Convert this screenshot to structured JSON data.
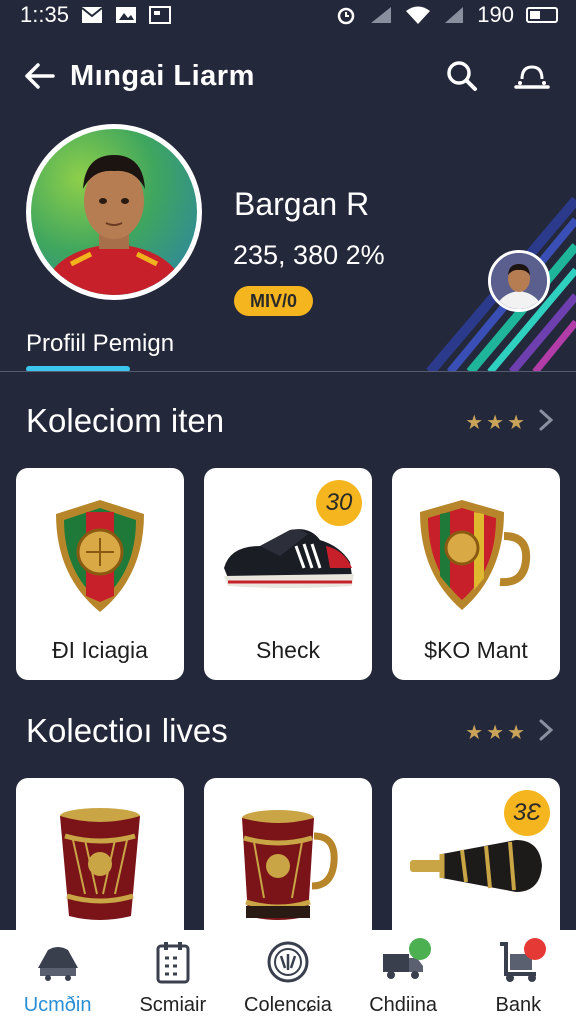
{
  "status_bar": {
    "time": "1::35",
    "battery": "190"
  },
  "app_bar": {
    "title": "Mıngai Liarm"
  },
  "profile": {
    "name": "Bargan R",
    "stat": "235, 380 2%",
    "rank": "MIV/0",
    "tab_label": "Profiil Pemign"
  },
  "sections": [
    {
      "title": "Koleciom iten",
      "stars": "★★★",
      "items": [
        {
          "label": "ÐI Iciagia",
          "icon": "shield-icon"
        },
        {
          "label": "Sheck",
          "icon": "sneaker-icon",
          "price": "30"
        },
        {
          "label": "$KO Mant",
          "icon": "shield-mug-icon"
        }
      ]
    },
    {
      "title": "Kolectioı lives",
      "stars": "★★★",
      "items": [
        {
          "label": "",
          "icon": "drum-cup-icon"
        },
        {
          "label": "",
          "icon": "drum-mug-icon"
        },
        {
          "label": "",
          "icon": "horn-icon",
          "price": "3Ɛ"
        }
      ]
    }
  ],
  "bottom_nav": [
    {
      "label": "Ucmðin",
      "icon": "cart-icon",
      "active": true
    },
    {
      "label": "Scmiair",
      "icon": "calendar-icon"
    },
    {
      "label": "Colencɕia",
      "icon": "badge-icon"
    },
    {
      "label": "Chdiina",
      "icon": "truck-icon"
    },
    {
      "label": "Bank",
      "icon": "trolley-icon"
    }
  ],
  "colors": {
    "accent": "#3cc6ee",
    "badge": "#f5b51f",
    "active_nav": "#2a8fd6",
    "background": "#23283a"
  }
}
